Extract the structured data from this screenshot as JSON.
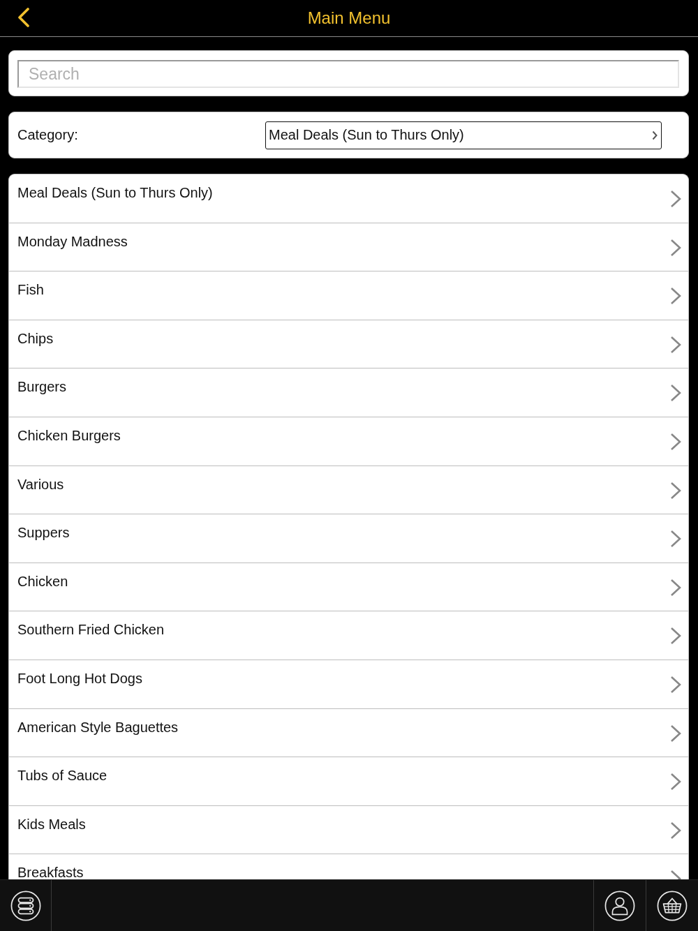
{
  "header": {
    "title": "Main Menu"
  },
  "search": {
    "placeholder": "Search"
  },
  "category": {
    "label": "Category:",
    "value": "Meal Deals (Sun to Thurs Only)"
  },
  "menu_items": [
    {
      "label": "Meal Deals (Sun to Thurs Only)"
    },
    {
      "label": "Monday Madness"
    },
    {
      "label": "Fish"
    },
    {
      "label": "Chips"
    },
    {
      "label": "Burgers"
    },
    {
      "label": "Chicken Burgers"
    },
    {
      "label": "Various"
    },
    {
      "label": "Suppers"
    },
    {
      "label": "Chicken"
    },
    {
      "label": "Southern Fried Chicken"
    },
    {
      "label": "Foot Long Hot Dogs"
    },
    {
      "label": "American Style Baguettes"
    },
    {
      "label": "Tubs of Sauce"
    },
    {
      "label": "Kids Meals"
    },
    {
      "label": "Breakfasts"
    }
  ]
}
